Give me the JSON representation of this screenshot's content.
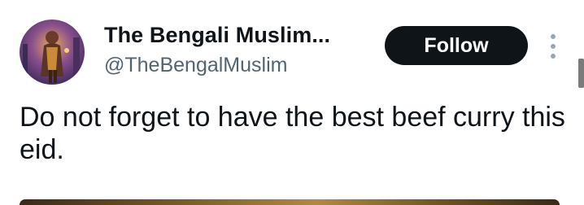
{
  "profile": {
    "display_name": "The Bengali Muslim...",
    "handle": "@TheBengalMuslim",
    "avatar_icon": "avatar-portrait-icon"
  },
  "actions": {
    "follow_label": "Follow",
    "more_icon": "more-vertical-icon"
  },
  "tweet": {
    "text": "Do not forget to have the best beef curry this eid."
  },
  "colors": {
    "text_primary": "#0f1419",
    "text_secondary": "#536471",
    "follow_bg": "#0f1419",
    "follow_text": "#ffffff"
  }
}
